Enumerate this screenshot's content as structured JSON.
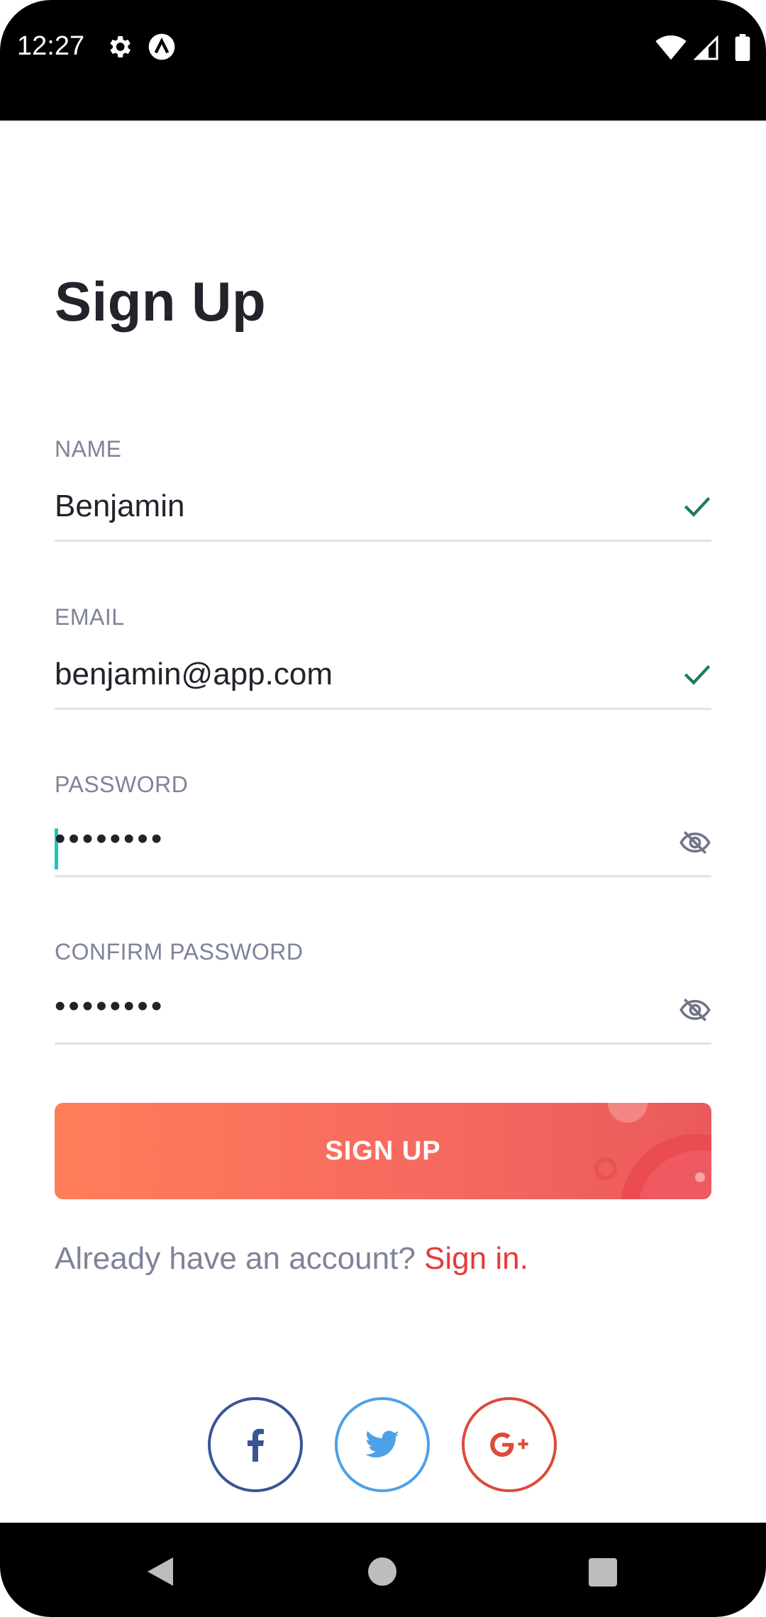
{
  "status_bar": {
    "time": "12:27",
    "icons": [
      "gear-icon",
      "a-badge-icon",
      "wifi-icon",
      "signal-icon",
      "battery-icon"
    ]
  },
  "title": "Sign Up",
  "fields": {
    "name": {
      "label": "NAME",
      "value": "Benjamin",
      "status_icon": "check-icon"
    },
    "email": {
      "label": "EMAIL",
      "value": "benjamin@app.com",
      "status_icon": "check-icon"
    },
    "password": {
      "label": "PASSWORD",
      "value": "••••••••",
      "toggle_icon": "eye-off-icon"
    },
    "confirm_password": {
      "label": "CONFIRM PASSWORD",
      "value": "••••••••",
      "toggle_icon": "eye-off-icon"
    }
  },
  "signup_button": {
    "label": "SIGN UP"
  },
  "account_prompt": {
    "text": "Already have an account?",
    "link": "Sign in."
  },
  "social": [
    {
      "name": "facebook-icon",
      "color": "#3b5497"
    },
    {
      "name": "twitter-icon",
      "color": "#4da1e6"
    },
    {
      "name": "google-plus-icon",
      "color": "#dc4a38"
    }
  ],
  "colors": {
    "accent": "#e8383a",
    "button_gradient_start": "#ff7e5a",
    "button_gradient_end": "#ea5a5c",
    "valid_check": "#1a7f5a",
    "caret": "#1ec6b8"
  },
  "nav_bar": {
    "icons": [
      "back-icon",
      "home-icon",
      "recents-icon"
    ]
  }
}
